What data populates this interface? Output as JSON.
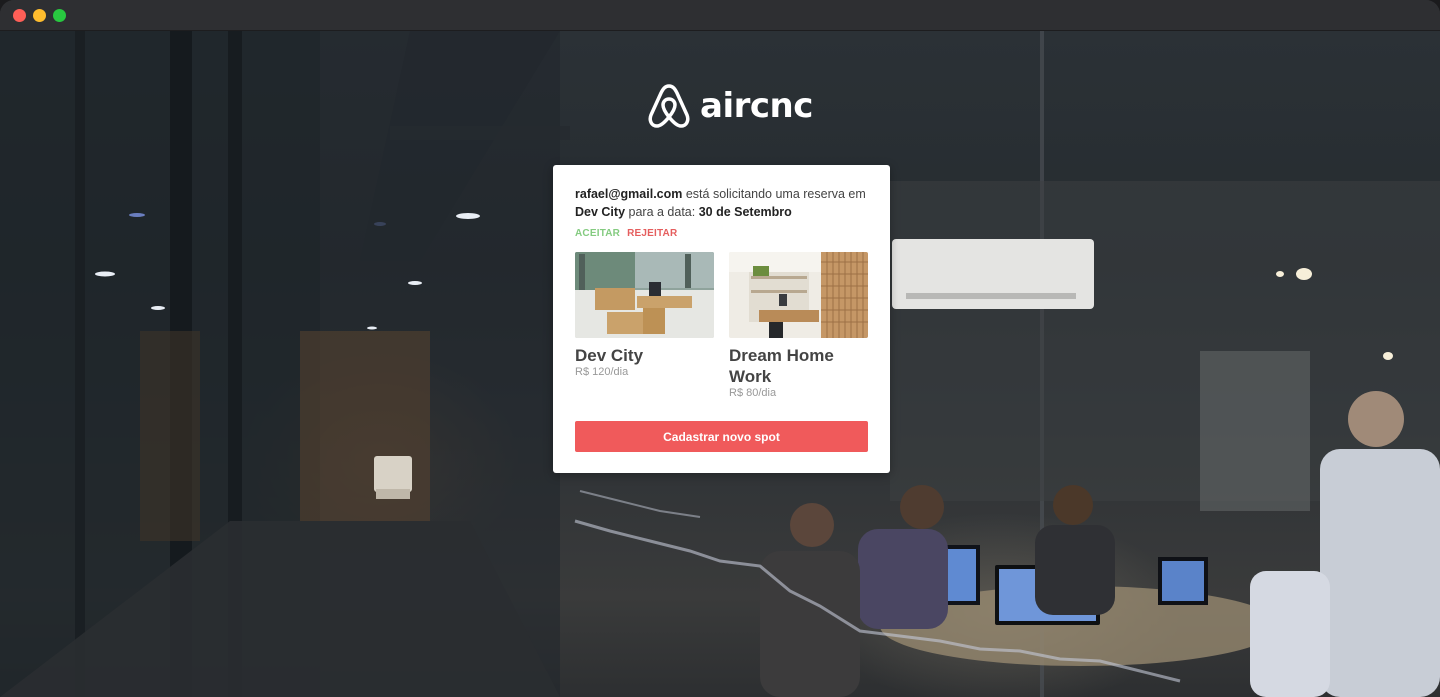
{
  "app": {
    "logo_text": "aircnc",
    "logo_icon": "airbnb-belo-icon"
  },
  "request": {
    "email": "rafael@gmail.com",
    "text1": " está solicitando uma reserva em ",
    "spot": "Dev City",
    "text2": " para a data: ",
    "date": "30 de Setembro",
    "accept_label": "ACEITAR",
    "reject_label": "REJEITAR"
  },
  "spots": [
    {
      "name": "Dev City",
      "price": "R$ 120/dia"
    },
    {
      "name": "Dream Home Work",
      "price": "R$ 80/dia"
    }
  ],
  "cta": {
    "label": "Cadastrar novo spot"
  },
  "colors": {
    "accent": "#f05a5b",
    "accept": "#84cb80",
    "reject": "#e55e5e"
  }
}
